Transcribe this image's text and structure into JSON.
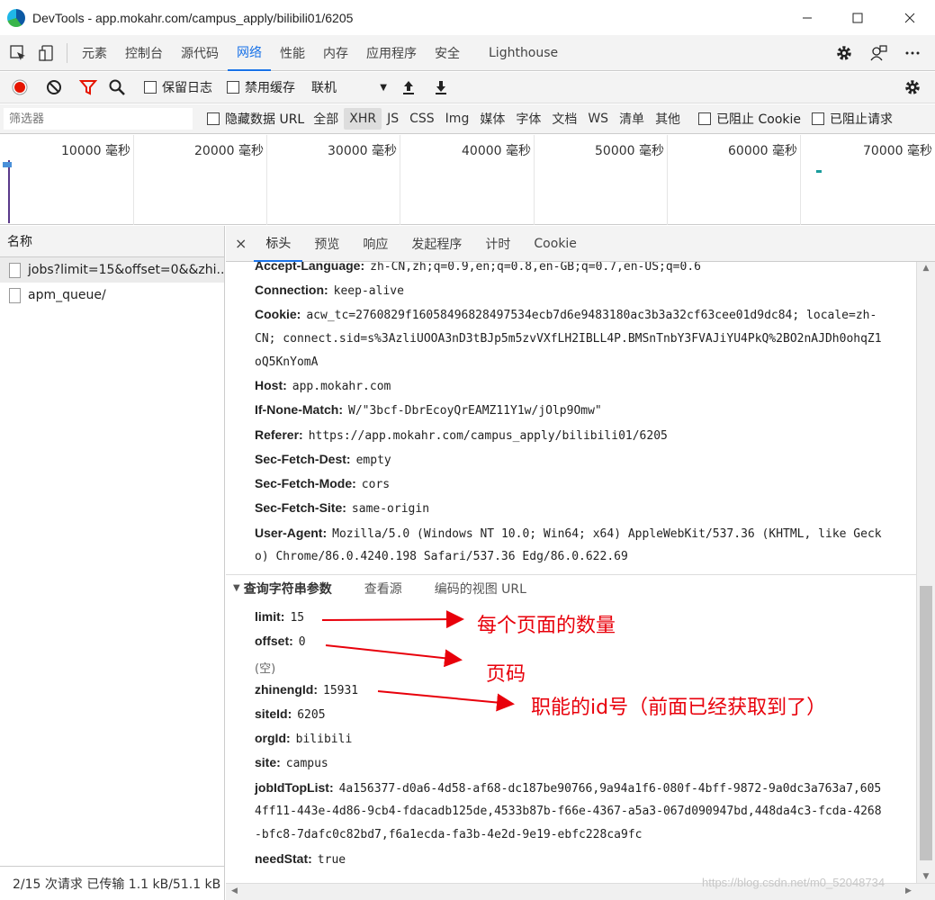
{
  "window": {
    "title": "DevTools - app.mokahr.com/campus_apply/bilibili01/6205",
    "minimize_icon": "minimize-icon",
    "maximize_icon": "maximize-icon",
    "close_icon": "close-icon"
  },
  "main_tabs": [
    "元素",
    "控制台",
    "源代码",
    "网络",
    "性能",
    "内存",
    "应用程序",
    "安全",
    "Lighthouse"
  ],
  "active_main_tab": "网络",
  "toolbar": {
    "preserve_log": "保留日志",
    "disable_cache": "禁用缓存",
    "throttling": "联机"
  },
  "filter": {
    "placeholder": "筛选器",
    "hide_data_urls": "隐藏数据 URL",
    "types": [
      "全部",
      "XHR",
      "JS",
      "CSS",
      "Img",
      "媒体",
      "字体",
      "文档",
      "WS",
      "清单",
      "其他"
    ],
    "active_type": "XHR",
    "blocked_cookies": "已阻止 Cookie",
    "blocked_requests": "已阻止请求"
  },
  "timeline": {
    "ticks": [
      "10000 毫秒",
      "20000 毫秒",
      "30000 毫秒",
      "40000 毫秒",
      "50000 毫秒",
      "60000 毫秒",
      "70000 毫秒"
    ]
  },
  "requests": {
    "header": "名称",
    "items": [
      "jobs?limit=15&offset=0&&zhi...",
      "apm_queue/"
    ],
    "status": "2/15 次请求  已传输 1.1 kB/51.1 kB"
  },
  "detail_tabs": [
    "标头",
    "预览",
    "响应",
    "发起程序",
    "计时",
    "Cookie"
  ],
  "active_detail_tab": "标头",
  "headers": {
    "accept_language_key": "Accept-Language:",
    "accept_language_val": "zh-CN,zh;q=0.9,en;q=0.8,en-GB;q=0.7,en-US;q=0.6",
    "connection_key": "Connection:",
    "connection_val": "keep-alive",
    "cookie_key": "Cookie:",
    "cookie_val_1": "acw_tc=2760829f16058496828497534ecb7d6e9483180ac3b3a32cf63cee01d9dc84; locale=zh-",
    "cookie_val_2": "CN; connect.sid=s%3AzliUOOA3nD3tBJp5m5zvVXfLH2IBLL4P.BMSnTnbY3FVAJiYU4PkQ%2BO2nAJDh0ohqZ1",
    "cookie_val_3": "oQ5KnYomA",
    "host_key": "Host:",
    "host_val": "app.mokahr.com",
    "if_none_match_key": "If-None-Match:",
    "if_none_match_val": "W/\"3bcf-DbrEcoyQrEAMZ11Y1w/jOlp9Omw\"",
    "referer_key": "Referer:",
    "referer_val": "https://app.mokahr.com/campus_apply/bilibili01/6205",
    "sec_fetch_dest_key": "Sec-Fetch-Dest:",
    "sec_fetch_dest_val": "empty",
    "sec_fetch_mode_key": "Sec-Fetch-Mode:",
    "sec_fetch_mode_val": "cors",
    "sec_fetch_site_key": "Sec-Fetch-Site:",
    "sec_fetch_site_val": "same-origin",
    "user_agent_key": "User-Agent:",
    "user_agent_val_1": "Mozilla/5.0 (Windows NT 10.0; Win64; x64) AppleWebKit/537.36 (KHTML, like Geck",
    "user_agent_val_2": "o) Chrome/86.0.4240.198 Safari/537.36 Edg/86.0.622.69"
  },
  "query_section": {
    "title": "查询字符串参数",
    "view_source": "查看源",
    "view_url_encoded": "编码的视图 URL"
  },
  "params": {
    "limit_key": "limit:",
    "limit_val": "15",
    "offset_key": "offset:",
    "offset_val": "0",
    "empty": "(空)",
    "zhinengId_key": "zhinengId:",
    "zhinengId_val": "15931",
    "siteId_key": "siteId:",
    "siteId_val": "6205",
    "orgId_key": "orgId:",
    "orgId_val": "bilibili",
    "site_key": "site:",
    "site_val": "campus",
    "jobIdTopList_key": "jobIdTopList:",
    "jobIdTopList_val_1": "4a156377-d0a6-4d58-af68-dc187be90766,9a94a1f6-080f-4bff-9872-9a0dc3a763a7,605",
    "jobIdTopList_val_2": "4ff11-443e-4d86-9cb4-fdacadb125de,4533b87b-f66e-4367-a5a3-067d090947bd,448da4c3-fcda-4268",
    "jobIdTopList_val_3": "-bfc8-7dafc0c82bd7,f6a1ecda-fa3b-4e2d-9e19-ebfc228ca9fc",
    "needStat_key": "needStat:",
    "needStat_val": "true"
  },
  "annotations": {
    "limit_note": "每个页面的数量",
    "offset_note": "页码",
    "zhineng_note": "职能的id号（前面已经获取到了）",
    "color": "#e8000b"
  },
  "watermark": "https://blog.csdn.net/m0_52048734"
}
